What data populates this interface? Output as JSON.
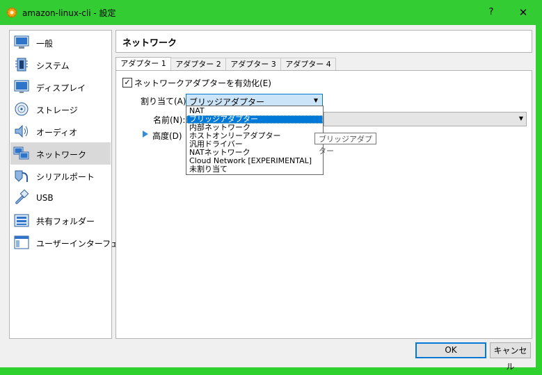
{
  "window": {
    "title": "amazon-linux-cli - 設定",
    "help_label": "?",
    "close_label": "✕",
    "icons": {
      "app": "virtualbox-gear-icon"
    }
  },
  "sidebar": {
    "items": [
      {
        "label": "一般",
        "icon": "general-icon"
      },
      {
        "label": "システム",
        "icon": "chip-icon"
      },
      {
        "label": "ディスプレイ",
        "icon": "monitor-icon"
      },
      {
        "label": "ストレージ",
        "icon": "disk-icon"
      },
      {
        "label": "オーディオ",
        "icon": "speaker-icon"
      },
      {
        "label": "ネットワーク",
        "icon": "network-icon",
        "selected": true
      },
      {
        "label": "シリアルポート",
        "icon": "serial-port-icon"
      },
      {
        "label": "USB",
        "icon": "usb-icon"
      },
      {
        "label": "共有フォルダー",
        "icon": "folder-icon"
      },
      {
        "label": "ユーザーインターフェース",
        "icon": "ui-window-icon"
      }
    ]
  },
  "main": {
    "title": "ネットワーク",
    "tabs": [
      {
        "label": "アダプター 1",
        "active": true
      },
      {
        "label": "アダプター 2"
      },
      {
        "label": "アダプター 3"
      },
      {
        "label": "アダプター 4"
      }
    ],
    "enable_label": "ネットワークアダプターを有効化(E)",
    "enable_checked": "✓",
    "attach_label": "割り当て(A):",
    "attach_value": "ブリッジアダプター",
    "name_label": "名前(N):",
    "advanced_label": "高度(D)",
    "dropdown_options": [
      "NAT",
      "ブリッジアダプター",
      "内部ネットワーク",
      "ホストオンリーアダプター",
      "汎用ドライバー",
      "NATネットワーク",
      "Cloud Network [EXPERIMENTAL]",
      "未割り当て"
    ],
    "highlighted_option_index": 1,
    "tooltip": "ブリッジアダプター"
  },
  "buttons": {
    "ok": "OK",
    "cancel": "キャンセル"
  },
  "colors": {
    "titlebar": "#33cc33",
    "accent": "#0078d7",
    "selected_row": "#d9d9d9"
  }
}
